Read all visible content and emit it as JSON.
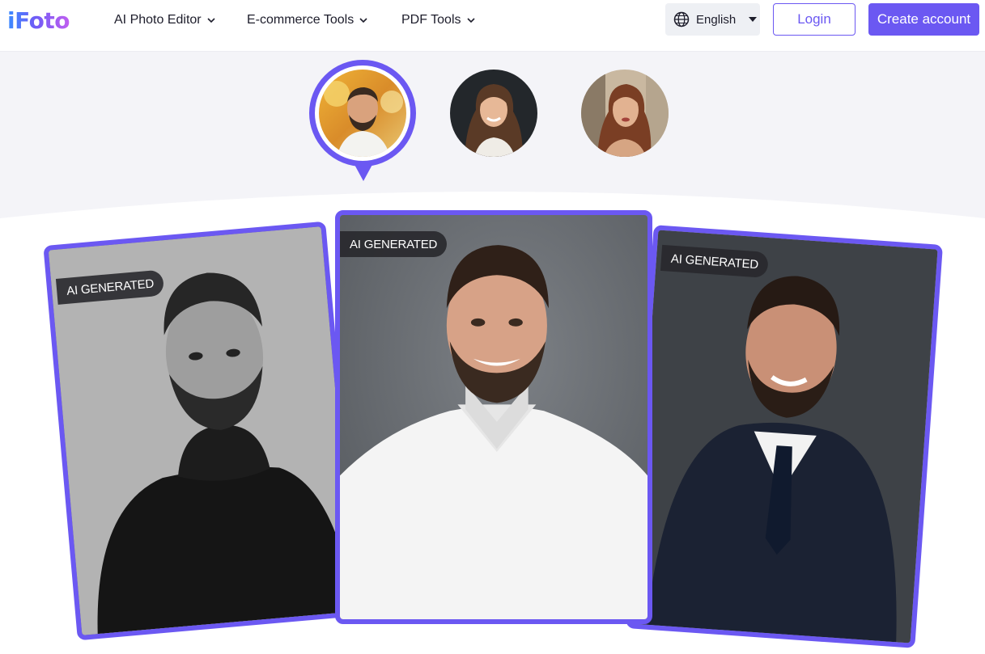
{
  "header": {
    "logo": "iFoto",
    "nav": [
      {
        "label": "AI Photo Editor"
      },
      {
        "label": "E-commerce Tools"
      },
      {
        "label": "PDF Tools"
      }
    ],
    "language": "English",
    "login_label": "Login",
    "create_account_label": "Create account"
  },
  "avatars": [
    {
      "name": "avatar-man",
      "selected": true
    },
    {
      "name": "avatar-woman-brunette",
      "selected": false
    },
    {
      "name": "avatar-woman-redhead",
      "selected": false
    }
  ],
  "cards": [
    {
      "badge": "AI GENERATED",
      "style": "black-turtleneck"
    },
    {
      "badge": "AI GENERATED",
      "style": "white-shirt"
    },
    {
      "badge": "AI GENERATED",
      "style": "dark-suit"
    }
  ],
  "colors": {
    "accent": "#6b58f2",
    "band_background": "#f4f4f8",
    "badge_background": "#28282c"
  }
}
